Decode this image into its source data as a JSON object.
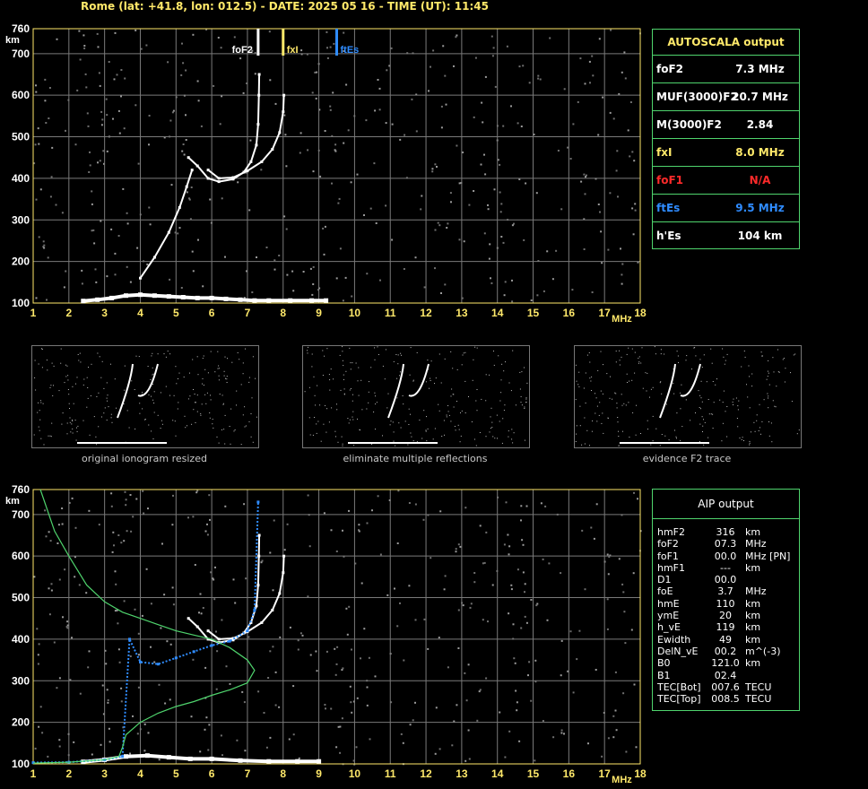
{
  "header": "Rome (lat: +41.8, lon: 012.5) - DATE: 2025 05 16 - TIME (UT): 11:45",
  "colors": {
    "yellow": "#ffe96a",
    "green": "#4fd46d",
    "red": "#ff2a2a",
    "blue": "#2f8cff",
    "grid": "#7a7a7a"
  },
  "chart_data": [
    {
      "type": "scatter",
      "title": "",
      "xlabel": "MHz",
      "ylabel": "km",
      "x_ticks": [
        1,
        2,
        3,
        4,
        5,
        6,
        7,
        8,
        9,
        10,
        11,
        12,
        13,
        14,
        15,
        16,
        17,
        18
      ],
      "y_ticks": [
        100,
        200,
        300,
        400,
        500,
        600,
        700,
        760
      ],
      "xlim": [
        1,
        18
      ],
      "ylim": [
        100,
        760
      ],
      "grid": true,
      "markers": [
        {
          "label": "foF2",
          "x": 7.3
        },
        {
          "label": "fxI",
          "x": 8.0
        },
        {
          "label": "ftEs",
          "x": 9.5
        }
      ],
      "series": [
        {
          "name": "E layer trace",
          "points": [
            [
              2.4,
              105
            ],
            [
              2.8,
              108
            ],
            [
              3.2,
              112
            ],
            [
              3.6,
              118
            ],
            [
              4.0,
              120
            ],
            [
              4.4,
              118
            ],
            [
              4.8,
              116
            ],
            [
              5.2,
              114
            ],
            [
              5.6,
              112
            ],
            [
              6.0,
              112
            ],
            [
              6.4,
              110
            ],
            [
              6.8,
              108
            ],
            [
              7.2,
              106
            ],
            [
              7.6,
              106
            ],
            [
              8.2,
              106
            ],
            [
              8.8,
              106
            ],
            [
              9.2,
              106
            ]
          ]
        },
        {
          "name": "F1/F2 low trace",
          "points": [
            [
              4.0,
              160
            ],
            [
              4.4,
              210
            ],
            [
              4.8,
              270
            ],
            [
              5.1,
              330
            ],
            [
              5.3,
              380
            ],
            [
              5.45,
              420
            ]
          ]
        },
        {
          "name": "F2 O trace",
          "points": [
            [
              5.35,
              450
            ],
            [
              5.6,
              430
            ],
            [
              5.9,
              400
            ],
            [
              6.2,
              392
            ],
            [
              6.6,
              398
            ],
            [
              6.9,
              415
            ],
            [
              7.1,
              440
            ],
            [
              7.25,
              480
            ],
            [
              7.3,
              530
            ],
            [
              7.32,
              600
            ],
            [
              7.33,
              650
            ]
          ]
        },
        {
          "name": "F2 X trace",
          "points": [
            [
              5.9,
              420
            ],
            [
              6.2,
              400
            ],
            [
              6.6,
              402
            ],
            [
              7.0,
              418
            ],
            [
              7.4,
              440
            ],
            [
              7.7,
              470
            ],
            [
              7.9,
              510
            ],
            [
              8.0,
              560
            ],
            [
              8.02,
              600
            ]
          ]
        }
      ]
    },
    {
      "type": "scatter",
      "title": "",
      "xlabel": "MHz",
      "ylabel": "km",
      "x_ticks": [
        1,
        2,
        3,
        4,
        5,
        6,
        7,
        8,
        9,
        10,
        11,
        12,
        13,
        14,
        15,
        16,
        17,
        18
      ],
      "y_ticks": [
        100,
        200,
        300,
        400,
        500,
        600,
        700,
        760
      ],
      "xlim": [
        1,
        18
      ],
      "ylim": [
        100,
        760
      ],
      "grid": true,
      "series": [
        {
          "name": "E layer trace",
          "points": [
            [
              2.4,
              105
            ],
            [
              3.0,
              110
            ],
            [
              3.6,
              118
            ],
            [
              4.2,
              120
            ],
            [
              4.8,
              116
            ],
            [
              5.4,
              112
            ],
            [
              6.0,
              112
            ],
            [
              6.8,
              108
            ],
            [
              7.6,
              106
            ],
            [
              8.4,
              106
            ],
            [
              9.0,
              106
            ]
          ]
        },
        {
          "name": "F2 O trace",
          "points": [
            [
              5.35,
              450
            ],
            [
              5.6,
              430
            ],
            [
              5.9,
              400
            ],
            [
              6.2,
              392
            ],
            [
              6.6,
              398
            ],
            [
              6.9,
              415
            ],
            [
              7.1,
              440
            ],
            [
              7.25,
              480
            ],
            [
              7.3,
              530
            ],
            [
              7.32,
              600
            ],
            [
              7.33,
              650
            ]
          ]
        },
        {
          "name": "F2 X trace",
          "points": [
            [
              5.9,
              420
            ],
            [
              6.2,
              400
            ],
            [
              6.6,
              402
            ],
            [
              7.0,
              418
            ],
            [
              7.4,
              440
            ],
            [
              7.7,
              470
            ],
            [
              7.9,
              510
            ],
            [
              8.0,
              560
            ],
            [
              8.02,
              600
            ]
          ]
        },
        {
          "name": "AIP computed trace",
          "color": "#2f8cff",
          "points": [
            [
              1.0,
              103
            ],
            [
              2.0,
              104
            ],
            [
              3.0,
              110
            ],
            [
              3.5,
              118
            ],
            [
              3.7,
              400
            ],
            [
              4.0,
              345
            ],
            [
              4.5,
              340
            ],
            [
              5.0,
              355
            ],
            [
              5.5,
              370
            ],
            [
              6.0,
              385
            ],
            [
              6.5,
              395
            ],
            [
              7.0,
              420
            ],
            [
              7.2,
              470
            ],
            [
              7.3,
              730
            ]
          ]
        },
        {
          "name": "Electron density profile",
          "color": "#4fd46d",
          "points": [
            [
              1.2,
              760
            ],
            [
              1.6,
              660
            ],
            [
              2.0,
              600
            ],
            [
              2.5,
              530
            ],
            [
              3.0,
              490
            ],
            [
              3.5,
              465
            ],
            [
              4.0,
              450
            ],
            [
              4.5,
              435
            ],
            [
              5.0,
              420
            ],
            [
              5.5,
              410
            ],
            [
              6.0,
              400
            ],
            [
              6.5,
              380
            ],
            [
              7.0,
              350
            ],
            [
              7.2,
              325
            ],
            [
              7.0,
              295
            ],
            [
              6.5,
              278
            ],
            [
              6.0,
              265
            ],
            [
              5.5,
              250
            ],
            [
              5.0,
              238
            ],
            [
              4.5,
              222
            ],
            [
              4.0,
              200
            ],
            [
              3.6,
              170
            ],
            [
              3.5,
              140
            ],
            [
              3.4,
              118
            ],
            [
              3.0,
              110
            ],
            [
              2.0,
              104
            ],
            [
              1.0,
              102
            ]
          ]
        }
      ]
    }
  ],
  "thumbs": [
    {
      "caption": "original ionogram resized"
    },
    {
      "caption": "eliminate multiple reflections"
    },
    {
      "caption": "evidence F2 trace"
    }
  ],
  "autoscala": {
    "title": "AUTOSCALA output",
    "rows": [
      {
        "k": "foF2",
        "v": "7.3 MHz",
        "color": "#ffffff"
      },
      {
        "k": "MUF(3000)F2",
        "v": "20.7 MHz",
        "color": "#ffffff"
      },
      {
        "k": "M(3000)F2",
        "v": "2.84",
        "color": "#ffffff"
      },
      {
        "k": "fxI",
        "v": "8.0 MHz",
        "color": "#ffe96a"
      },
      {
        "k": "foF1",
        "v": "N/A",
        "color": "#ff2a2a"
      },
      {
        "k": "ftEs",
        "v": "9.5 MHz",
        "color": "#2f8cff"
      },
      {
        "k": "h'Es",
        "v": "104    km",
        "color": "#ffffff"
      }
    ]
  },
  "aip": {
    "title": "AIP output",
    "rows": [
      {
        "k": "hmF2",
        "v": "316",
        "u": "km"
      },
      {
        "k": "foF2",
        "v": "07.3",
        "u": "MHz"
      },
      {
        "k": "foF1",
        "v": "00.0",
        "u": "MHz   [PN]"
      },
      {
        "k": "hmF1",
        "v": "---",
        "u": "km"
      },
      {
        "k": "D1",
        "v": "00.0",
        "u": ""
      },
      {
        "k": "foE",
        "v": "3.7",
        "u": "MHz"
      },
      {
        "k": "hmE",
        "v": "110",
        "u": "km"
      },
      {
        "k": "ymE",
        "v": "20",
        "u": "km"
      },
      {
        "k": "h_vE",
        "v": "119",
        "u": "km"
      },
      {
        "k": "Ewidth",
        "v": "49",
        "u": "km"
      },
      {
        "k": "DelN_vE",
        "v": "00.2",
        "u": "m^(-3)"
      },
      {
        "k": "B0",
        "v": "121.0",
        "u": "km"
      },
      {
        "k": "B1",
        "v": "02.4",
        "u": ""
      },
      {
        "k": "TEC[Bot]",
        "v": "007.6",
        "u": "TECU"
      },
      {
        "k": "TEC[Top]",
        "v": "008.5",
        "u": "TECU"
      }
    ]
  }
}
